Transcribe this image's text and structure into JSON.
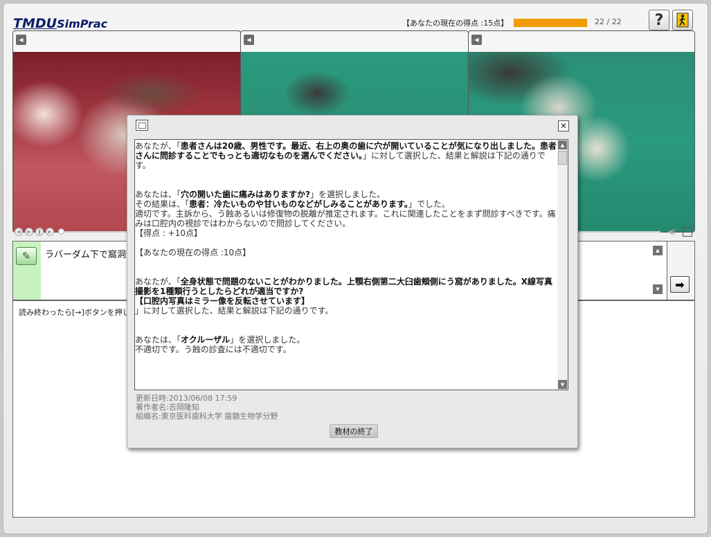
{
  "header": {
    "logo_main": "TMDU",
    "logo_sub": "SimPrac",
    "score_label": "【あなたの現在の得点 :15点】",
    "progress_percent": 100,
    "page_count": "22 / 22",
    "help_label": "?",
    "exit_icon": "exit-door-icon"
  },
  "panels": [
    {
      "button": "◀"
    },
    {
      "button": "◀"
    },
    {
      "button": "◀"
    }
  ],
  "question": {
    "text": "ラバーダム下で窩洞形",
    "next_label": "➡"
  },
  "bottom": {
    "text": "読み終わったら[→]ボタンを押して"
  },
  "dialog": {
    "p1_a": "あなたが、「",
    "p1_b": "患者さんは20歳、男性です。最近、右上の奥の歯に穴が開いていることが気になり出しました。患者さんに問診することでもっとも適切なものを選んでください。",
    "p1_c": "」に対して選択した、結果と解説は下記の通りです。",
    "p2_a": "あなたは、「",
    "p2_b": "穴の開いた歯に痛みはありますか?",
    "p2_c": "」を選択しました。",
    "p3_a": "その結果は、「",
    "p3_b": "患者：冷たいものや甘いものなどがしみることがあります。",
    "p3_c": "」でした。",
    "p4": "適切です。主訴から、う蝕あるいは修復物の脱離が推定されます。これに関連したことをまず問診すべきです。痛みは口腔内の視診ではわからないので問診してください。",
    "p5": "【得点 : +10点】",
    "p6": "【あなたの現在の得点 :10点】",
    "p7_a": "あなたが、「",
    "p7_b": "全身状態で問題のないことがわかりました。上顎右側第二大臼歯頬側にう窩がありました。X線写真撮影を1種類行うとしたらどれが適当ですか?",
    "p7_b2": "【口腔内写真はミラー像を反転させています】",
    "p7_c": "」に対して選択した、結果と解説は下記の通りです。",
    "p8_a": "あなたは、「",
    "p8_b": "オクルーザル",
    "p8_c": "」を選択しました。",
    "p9": "不適切です。う蝕の診査には不適切です。",
    "updated": "更新日時:2013/06/08 17:59",
    "author": "著作者名:吉岡隆知",
    "org": "組織名:東京医科歯科大学 歯髄生物学分野",
    "end_button": "教材の終了"
  }
}
